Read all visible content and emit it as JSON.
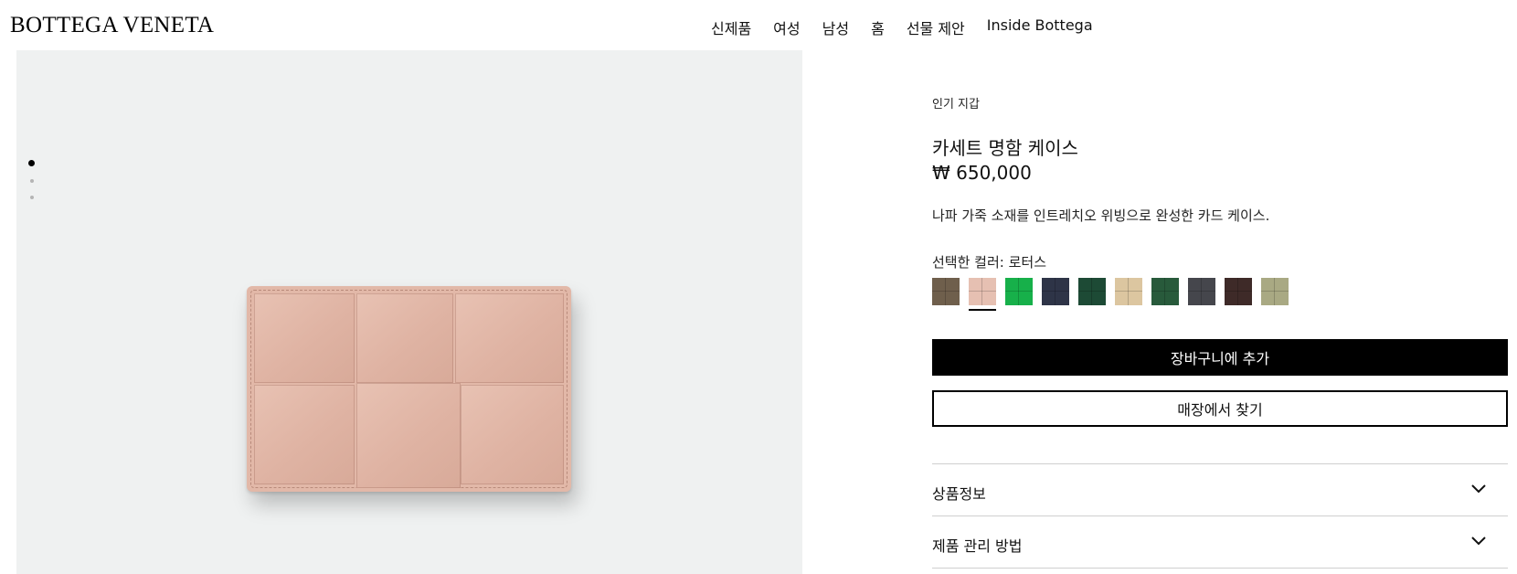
{
  "brand": {
    "logo": "BOTTEGA VENETA"
  },
  "nav": {
    "items": [
      {
        "label": "신제품"
      },
      {
        "label": "여성"
      },
      {
        "label": "남성"
      },
      {
        "label": "홈"
      },
      {
        "label": "선물 제안"
      },
      {
        "label": "Inside Bottega"
      }
    ]
  },
  "gallery": {
    "image_count": 3,
    "active_index": 0,
    "product_color": "#e2b8a8"
  },
  "product": {
    "category": "인기 지갑",
    "title": "카세트 명함 케이스",
    "price": "₩ 650,000",
    "description": "나파 가죽 소재를 인트레치오 위빙으로 완성한 카드 케이스.",
    "selected_color_label": "선택한 컬러: 로터스",
    "swatches": [
      {
        "color": "#6f5f4c"
      },
      {
        "color": "#e6c0b2",
        "selected": true
      },
      {
        "color": "#17b04a"
      },
      {
        "color": "#2e3447"
      },
      {
        "color": "#1d4a35"
      },
      {
        "color": "#dcc6a0"
      },
      {
        "color": "#285a3b"
      },
      {
        "color": "#45464c"
      },
      {
        "color": "#3e2a28"
      },
      {
        "color": "#a9a983"
      }
    ]
  },
  "actions": {
    "add_to_cart": "장바구니에 추가",
    "find_in_store": "매장에서 찾기"
  },
  "accordion": {
    "items": [
      {
        "label": "상품정보",
        "icon": "chevron-down-icon"
      },
      {
        "label": "제품 관리 방법",
        "icon": "chevron-down-icon"
      }
    ]
  }
}
